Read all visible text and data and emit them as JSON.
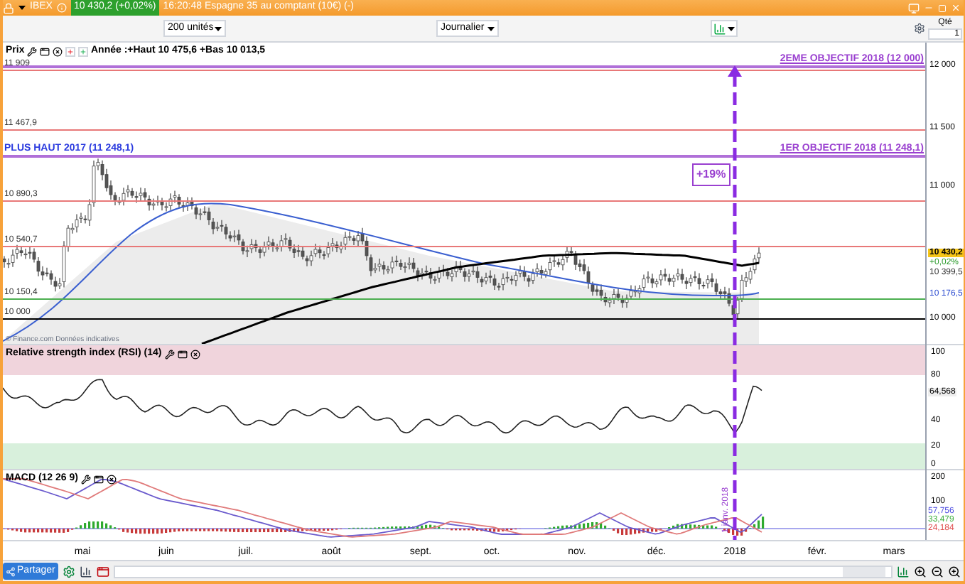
{
  "title_bar": {
    "symbol": "IBEX",
    "quote": "10 430,2 (+0,02%)",
    "info": "16:20:48 Espagne 35 au comptant (10€) (-)"
  },
  "toolbar": {
    "units": "200 unités",
    "period": "Journalier",
    "qty_label": "Qté",
    "qty_value": "1"
  },
  "price_panel": {
    "title": "Prix",
    "summary": "Année :+Haut 10 475,6 +Bas 10 013,5",
    "levels": [
      {
        "label": "11 909",
        "color": "#e87878"
      },
      {
        "label": "11 467,9",
        "color": "#e87878"
      },
      {
        "label": "10 890,3",
        "color": "#e87878"
      },
      {
        "label": "10 540,7",
        "color": "#e87878"
      },
      {
        "label": "10 150,4",
        "color": "#4caf50"
      },
      {
        "label": "10 000",
        "color": "#000000"
      }
    ],
    "objectives": [
      {
        "label": "2EME OBJECTIF 2018 (12 000)"
      },
      {
        "label": "1ER OBJECTIF 2018 (11 248,1)",
        "left_label": "PLUS HAUT 2017 (11 248,1)"
      }
    ],
    "gain_label": "+19%",
    "date_label": "1 janv. 2018",
    "source": "© Finance.com Données indicatives",
    "axis": {
      "ticks": [
        "12 000",
        "11 500",
        "11 000",
        "10 000"
      ],
      "markers": [
        {
          "kind": "last",
          "text": "10 430,2"
        },
        {
          "kind": "change",
          "text": "+0,02%"
        },
        {
          "kind": "value",
          "text": "10 399,5"
        },
        {
          "kind": "average",
          "text": "10 176,5"
        }
      ]
    }
  },
  "rsi_panel": {
    "title": "Relative strength index (RSI) (14)",
    "axis": {
      "ticks": [
        "100",
        "80",
        "40",
        "20",
        "0"
      ],
      "reading": "64,568"
    }
  },
  "macd_panel": {
    "title": "MACD (12 26 9)",
    "axis": {
      "ticks": [
        "200",
        "100"
      ],
      "readings": [
        {
          "text": "57,756",
          "color": "#4a4ae0"
        },
        {
          "text": "33,479",
          "color": "#40b040"
        },
        {
          "text": "24,184",
          "color": "#e05050"
        }
      ]
    }
  },
  "x_axis": [
    "mai",
    "juin",
    "juil.",
    "août",
    "sept.",
    "oct.",
    "nov.",
    "déc.",
    "2018",
    "févr.",
    "mars"
  ],
  "bottom_bar": {
    "share": "Partager"
  }
}
